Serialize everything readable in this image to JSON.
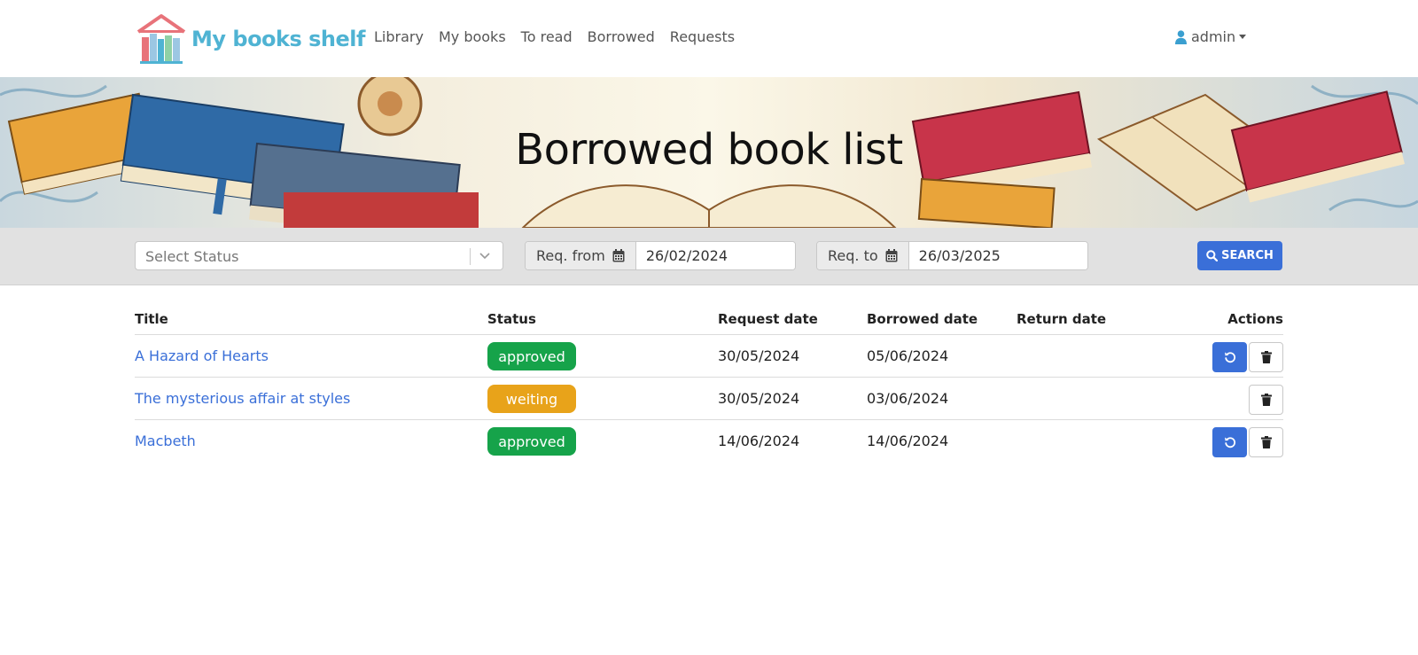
{
  "app": {
    "name": "My books shelf"
  },
  "nav": {
    "links": [
      "Library",
      "My books",
      "To read",
      "Borrowed",
      "Requests"
    ],
    "user": "admin"
  },
  "banner": {
    "title": "Borrowed book list"
  },
  "filters": {
    "status_placeholder": "Select Status",
    "req_from_label": "Req. from",
    "req_from_value": "26/02/2024",
    "req_to_label": "Req. to",
    "req_to_value": "26/03/2025",
    "search_label": "SEARCH"
  },
  "table": {
    "headers": {
      "title": "Title",
      "status": "Status",
      "request_date": "Request date",
      "borrowed_date": "Borrowed date",
      "return_date": "Return date",
      "actions": "Actions"
    },
    "rows": [
      {
        "title": "A Hazard of Hearts",
        "status": "approved",
        "request_date": "30/05/2024",
        "borrowed_date": "05/06/2024",
        "return_date": "",
        "can_return": true
      },
      {
        "title": "The mysterious affair at styles",
        "status": "weiting",
        "request_date": "30/05/2024",
        "borrowed_date": "03/06/2024",
        "return_date": "",
        "can_return": false
      },
      {
        "title": "Macbeth",
        "status": "approved",
        "request_date": "14/06/2024",
        "borrowed_date": "14/06/2024",
        "return_date": "",
        "can_return": true
      }
    ]
  },
  "colors": {
    "brand": "#4fb3d3",
    "primary": "#3a6fd8",
    "approved": "#16a34a",
    "waiting": "#e8a31a"
  },
  "icons": {
    "logo": "bookshelf-house-icon",
    "user": "user-icon",
    "calendar": "calendar-icon",
    "search": "search-icon",
    "return": "undo-icon",
    "delete": "trash-icon"
  }
}
